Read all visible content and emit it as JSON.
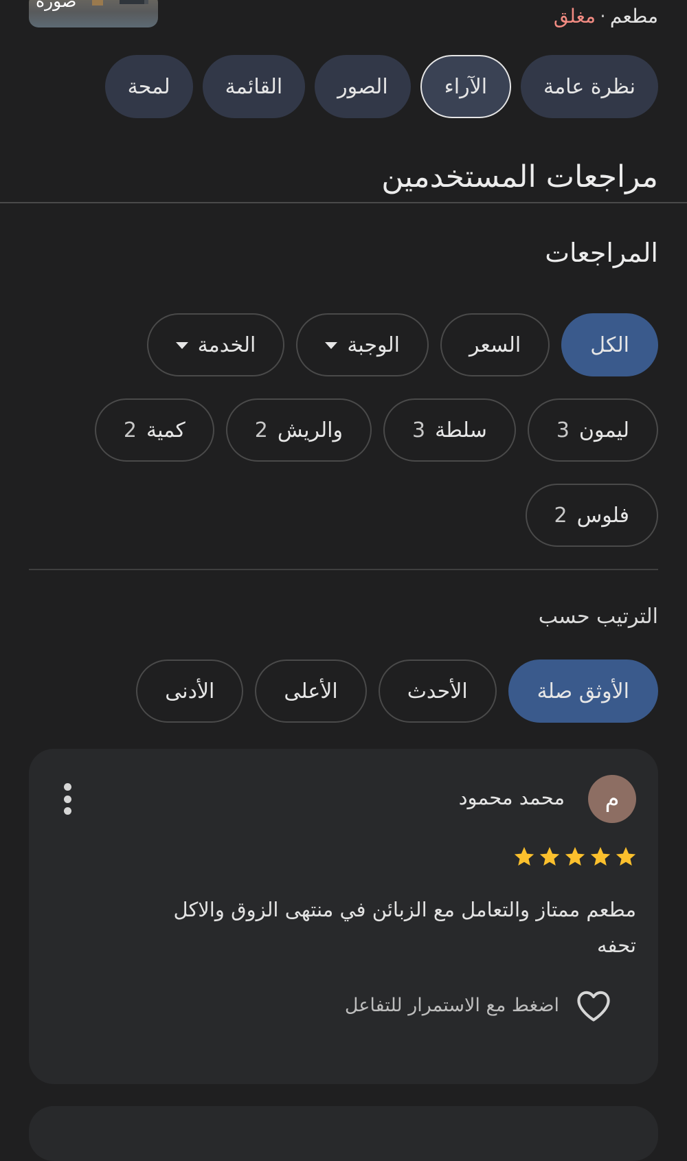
{
  "header": {
    "photo_label": "صورة",
    "place_kind": "مطعم",
    "separator": "·",
    "status": "مغلق",
    "status_color": "#f28b82"
  },
  "tabs": [
    {
      "label": "نظرة عامة",
      "active": false
    },
    {
      "label": "الآراء",
      "active": true
    },
    {
      "label": "الصور",
      "active": false
    },
    {
      "label": "القائمة",
      "active": false
    },
    {
      "label": "لمحة",
      "active": false
    }
  ],
  "section_title": "مراجعات المستخدمين",
  "reviews_heading": "المراجعات",
  "filters": {
    "all": "الكل",
    "price": "السعر",
    "meal": "الوجبة",
    "service": "الخدمة"
  },
  "topics": [
    {
      "label": "ليمون",
      "count": "3"
    },
    {
      "label": "سلطة",
      "count": "3"
    },
    {
      "label": "والريش",
      "count": "2"
    },
    {
      "label": "كمية",
      "count": "2"
    },
    {
      "label": "فلوس",
      "count": "2"
    }
  ],
  "sort": {
    "label": "الترتيب حسب",
    "options": [
      "الأوثق صلة",
      "الأحدث",
      "الأعلى",
      "الأدنى"
    ],
    "selected": "الأوثق صلة"
  },
  "review": {
    "avatar_letter": "م",
    "avatar_color": "#8d6e63",
    "author": "محمد محمود",
    "rating": 5,
    "star_color": "#fbc02d",
    "text": "مطعم ممتاز والتعامل مع الزبائن في منتهى الزوق والاكل تحفه",
    "like_hint": "اضغط مع الاستمرار للتفاعل",
    "icons": {
      "more": "more-vert-icon",
      "like": "heart-outline-icon",
      "star": "star-icon"
    }
  },
  "accent": {
    "selected_chip": "#3a5a8c",
    "tab_bg": "#323848"
  }
}
